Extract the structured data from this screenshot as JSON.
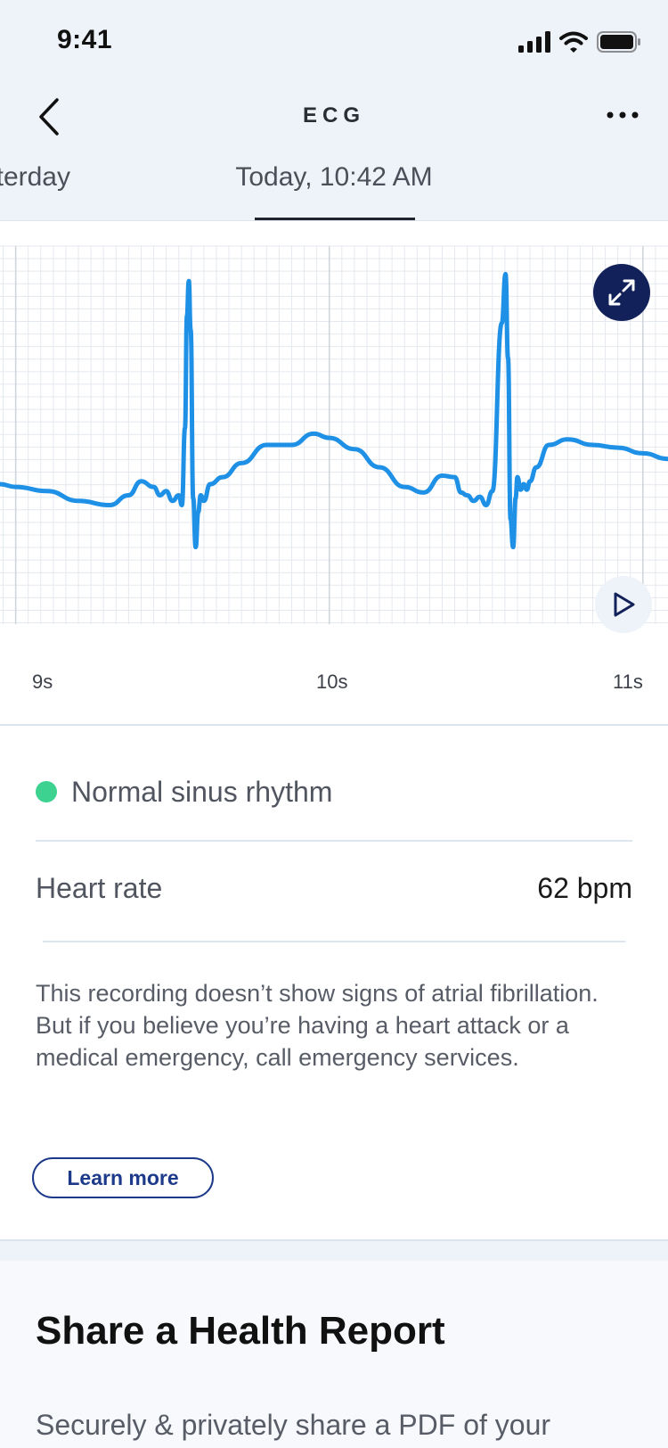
{
  "status_bar": {
    "time": "9:41"
  },
  "nav": {
    "title": "ECG"
  },
  "tabs": [
    {
      "label": "Yesterday"
    },
    {
      "label": "Today, 10:42 AM"
    }
  ],
  "chart_data": {
    "type": "line",
    "title": "",
    "xlabel": "",
    "ylabel": "",
    "x_ticks": [
      "9s",
      "10s",
      "11s"
    ],
    "xlim": [
      8.95,
      11.08
    ],
    "ylim": [
      -1.0,
      1.7
    ],
    "grid": true,
    "series": [
      {
        "color": "#1e90e6",
        "x": [
          8.95,
          9.0,
          9.1,
          9.2,
          9.3,
          9.36,
          9.4,
          9.44,
          9.46,
          9.48,
          9.5,
          9.52,
          9.53,
          9.54,
          9.546,
          9.552,
          9.558,
          9.566,
          9.574,
          9.582,
          9.59,
          9.6,
          9.62,
          9.66,
          9.72,
          9.8,
          9.88,
          9.95,
          10.0,
          10.08,
          10.16,
          10.24,
          10.3,
          10.36,
          10.4,
          10.42,
          10.44,
          10.46,
          10.48,
          10.5,
          10.52,
          10.55,
          10.562,
          10.57,
          10.578,
          10.586,
          10.594,
          10.6,
          10.61,
          10.62,
          10.63,
          10.64,
          10.66,
          10.7,
          10.76,
          10.84,
          10.92,
          11.0,
          11.08
        ],
        "y": [
          0.0,
          -0.02,
          -0.05,
          -0.12,
          -0.15,
          -0.08,
          0.02,
          -0.02,
          -0.08,
          -0.05,
          -0.12,
          -0.08,
          -0.15,
          0.4,
          1.2,
          1.45,
          1.1,
          -0.1,
          -0.45,
          -0.2,
          -0.08,
          -0.12,
          0.0,
          0.05,
          0.15,
          0.28,
          0.28,
          0.36,
          0.33,
          0.25,
          0.12,
          -0.02,
          -0.06,
          0.06,
          0.05,
          -0.06,
          -0.08,
          -0.12,
          -0.09,
          -0.15,
          -0.05,
          1.15,
          1.5,
          0.9,
          -0.25,
          -0.45,
          -0.1,
          0.05,
          -0.04,
          0.0,
          -0.04,
          0.02,
          0.12,
          0.28,
          0.32,
          0.28,
          0.26,
          0.22,
          0.18
        ]
      }
    ]
  },
  "result": {
    "classification": "Normal sinus rhythm",
    "status_color": "#3dd28f",
    "heart_rate_label": "Heart rate",
    "heart_rate_value": "62 bpm",
    "description_1": "This recording doesn’t show signs of atrial fibrillation.",
    "description_2": "But if you believe you’re having a heart attack or a medical emergency, call emergency services.",
    "learn_more": "Learn more"
  },
  "share": {
    "title": "Share a Health Report",
    "description": "Securely & privately share a PDF of your"
  },
  "icons": [
    "back-chevron-icon",
    "more-dots-icon",
    "expand-icon",
    "play-icon",
    "signal-icon",
    "wifi-icon",
    "battery-icon"
  ],
  "colors": {
    "accent": "#1d3a8a",
    "trace": "#1e90e6",
    "header_bg": "#eef3f9",
    "expand_bg": "#122159"
  }
}
